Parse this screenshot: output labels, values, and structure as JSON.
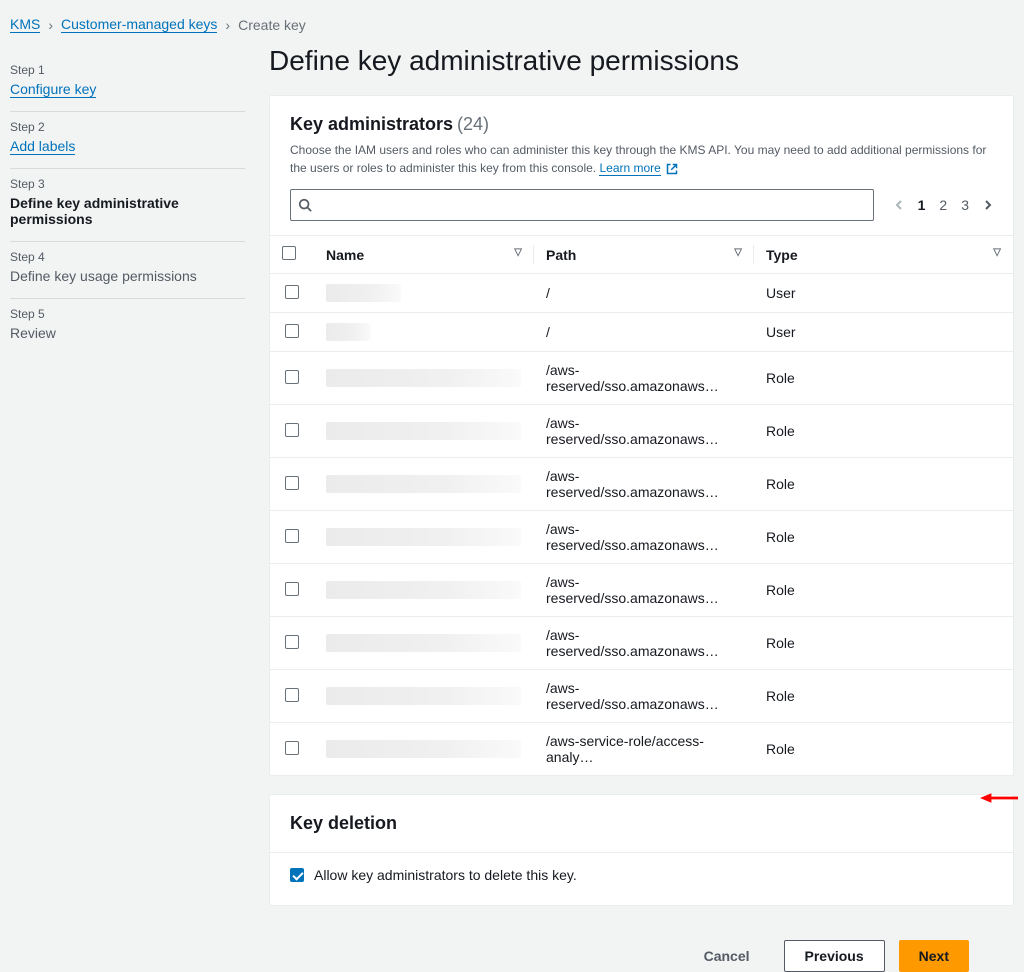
{
  "breadcrumb": {
    "items": [
      {
        "label": "KMS",
        "link": true
      },
      {
        "label": "Customer-managed keys",
        "link": true
      },
      {
        "label": "Create key",
        "link": false
      }
    ]
  },
  "sidebar": {
    "steps": [
      {
        "num": "Step 1",
        "title": "Configure key",
        "state": "link"
      },
      {
        "num": "Step 2",
        "title": "Add labels",
        "state": "link"
      },
      {
        "num": "Step 3",
        "title": "Define key administrative permissions",
        "state": "active"
      },
      {
        "num": "Step 4",
        "title": "Define key usage permissions",
        "state": "normal"
      },
      {
        "num": "Step 5",
        "title": "Review",
        "state": "normal"
      }
    ]
  },
  "main": {
    "heading": "Define key administrative permissions",
    "admins": {
      "title": "Key administrators",
      "count": "(24)",
      "desc_pre": "Choose the IAM users and roles who can administer this key through the KMS API. You may need to add additional permissions for the users or roles to administer this key from this console. ",
      "learn_more": "Learn more",
      "columns": {
        "name": "Name",
        "path": "Path",
        "type": "Type"
      },
      "rows": [
        {
          "name_blur": "w1",
          "path": "/",
          "type": "User"
        },
        {
          "name_blur": "w2",
          "path": "/",
          "type": "User"
        },
        {
          "name_blur": "w3",
          "path": "/aws-reserved/sso.amazonaws…",
          "type": "Role"
        },
        {
          "name_blur": "w3",
          "path": "/aws-reserved/sso.amazonaws…",
          "type": "Role"
        },
        {
          "name_blur": "w3",
          "path": "/aws-reserved/sso.amazonaws…",
          "type": "Role"
        },
        {
          "name_blur": "w3",
          "path": "/aws-reserved/sso.amazonaws…",
          "type": "Role"
        },
        {
          "name_blur": "w3",
          "path": "/aws-reserved/sso.amazonaws…",
          "type": "Role"
        },
        {
          "name_blur": "w3",
          "path": "/aws-reserved/sso.amazonaws…",
          "type": "Role"
        },
        {
          "name_blur": "w3",
          "path": "/aws-reserved/sso.amazonaws…",
          "type": "Role"
        },
        {
          "name_blur": "w3",
          "path": "/aws-service-role/access-analy…",
          "type": "Role"
        }
      ],
      "pagination": {
        "pages": [
          "1",
          "2",
          "3"
        ],
        "active": 0
      }
    },
    "deletion": {
      "title": "Key deletion",
      "checkbox_label": "Allow key administrators to delete this key.",
      "checked": true
    },
    "footer": {
      "cancel": "Cancel",
      "previous": "Previous",
      "next": "Next"
    }
  }
}
